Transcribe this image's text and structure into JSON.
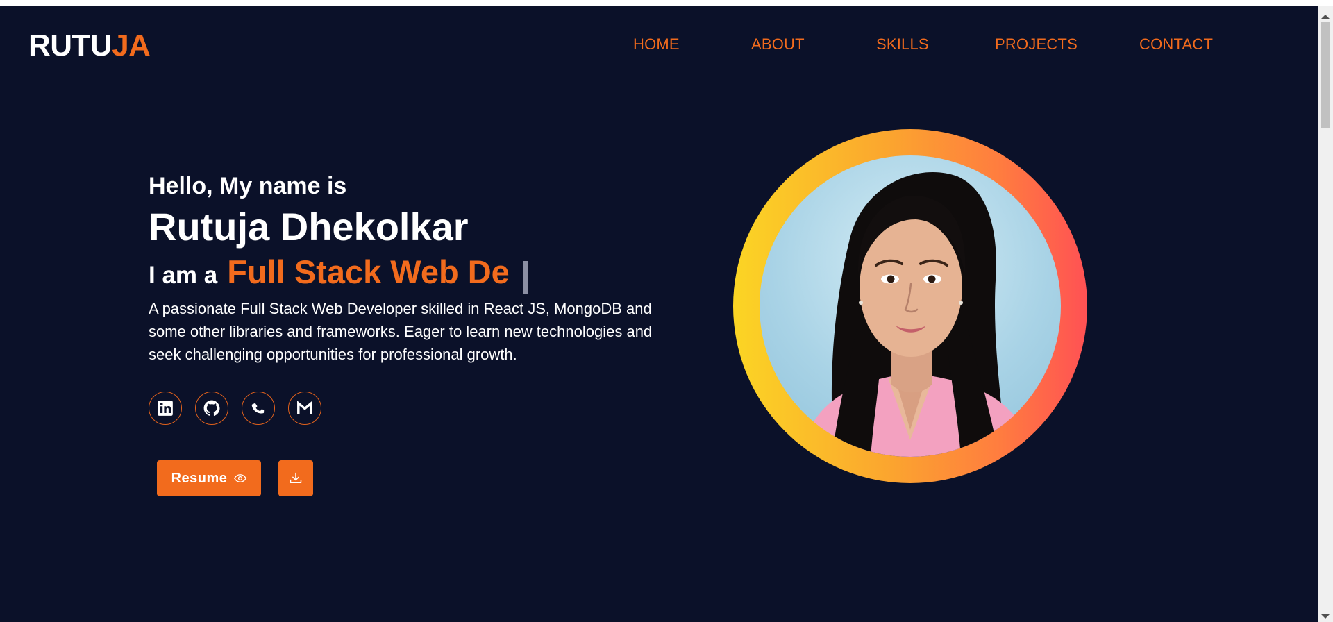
{
  "logo": {
    "part1": "RUTU",
    "part2": "JA"
  },
  "nav": {
    "items": [
      {
        "label": "HOME"
      },
      {
        "label": "ABOUT"
      },
      {
        "label": "SKILLS"
      },
      {
        "label": "PROJECTS"
      },
      {
        "label": "CONTACT"
      }
    ]
  },
  "hero": {
    "greeting": "Hello, My name is",
    "name": "Rutuja Dhekolkar",
    "role_prefix": "I am a",
    "role_typed": "Full Stack Web De",
    "description": "A passionate Full Stack Web Developer skilled in React JS, MongoDB and some other libraries and frameworks. Eager to learn new technologies and seek challenging opportunities for professional growth."
  },
  "socials": [
    {
      "icon": "linkedin-icon"
    },
    {
      "icon": "github-icon"
    },
    {
      "icon": "phone-icon"
    },
    {
      "icon": "gmail-icon"
    }
  ],
  "buttons": {
    "resume_label": "Resume",
    "resume_icon": "eye-icon",
    "download_icon": "download-icon"
  },
  "colors": {
    "background": "#0b1129",
    "accent": "#f26b1d",
    "ring_gradient": [
      "#fbd524",
      "#fba42f",
      "#ff7d3f",
      "#ff5154"
    ]
  }
}
